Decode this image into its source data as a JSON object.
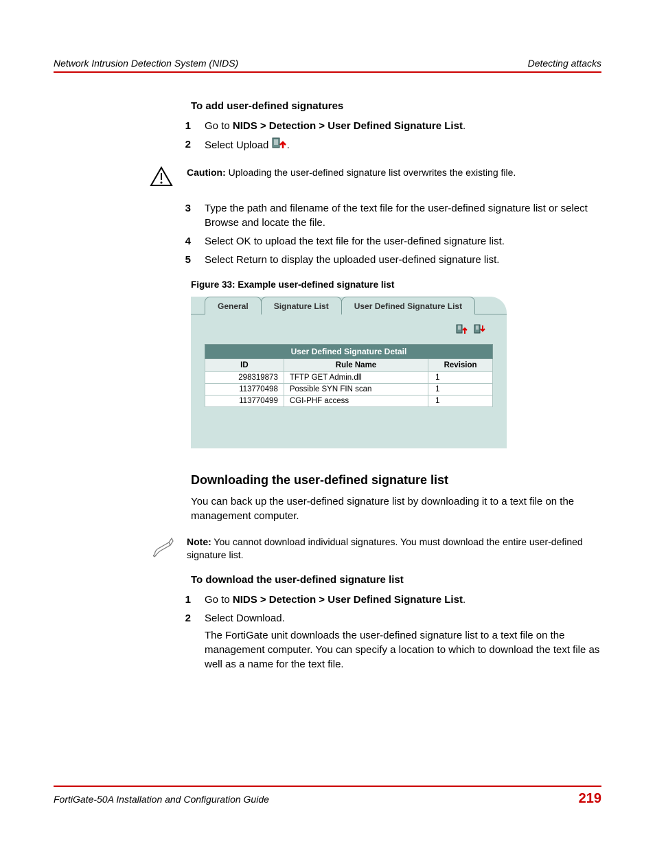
{
  "header": {
    "left": "Network Intrusion Detection System (NIDS)",
    "right": "Detecting attacks"
  },
  "proc1": {
    "title": "To add user-defined signatures",
    "steps": {
      "s1": {
        "num": "1",
        "pre": "Go to ",
        "bold": "NIDS > Detection > User Defined Signature List",
        "post": "."
      },
      "s2": {
        "num": "2",
        "pre": "Select Upload ",
        "post": "."
      },
      "s3": {
        "num": "3",
        "text": "Type the path and filename of the text file for the user-defined signature list or select Browse and locate the file."
      },
      "s4": {
        "num": "4",
        "text": "Select OK to upload the text file for the user-defined signature list."
      },
      "s5": {
        "num": "5",
        "text": "Select Return to display the uploaded user-defined signature list."
      }
    }
  },
  "caution": {
    "label": "Caution:",
    "text": " Uploading the user-defined signature list overwrites the existing file."
  },
  "figure": {
    "caption": "Figure 33: Example user-defined signature list",
    "tabs": [
      "General",
      "Signature List",
      "User Defined Signature List"
    ],
    "titlebar": "User Defined Signature Detail",
    "cols": [
      "ID",
      "Rule Name",
      "Revision"
    ],
    "rows": [
      {
        "id": "298319873",
        "name": "TFTP GET Admin.dll",
        "rev": "1"
      },
      {
        "id": "113770498",
        "name": "Possible SYN FIN scan",
        "rev": "1"
      },
      {
        "id": "113770499",
        "name": "CGI-PHF access",
        "rev": "1"
      }
    ]
  },
  "section2": {
    "heading": "Downloading the user-defined signature list",
    "para": "You can back up the user-defined signature list by downloading it to a text file on the management computer."
  },
  "note": {
    "label": "Note:",
    "text": " You cannot download individual signatures. You must download the entire user-defined signature list."
  },
  "proc2": {
    "title": "To download the user-defined signature list",
    "steps": {
      "s1": {
        "num": "1",
        "pre": "Go to ",
        "bold": "NIDS > Detection > User Defined Signature List",
        "post": "."
      },
      "s2": {
        "num": "2",
        "text": "Select Download.",
        "sub": "The FortiGate unit downloads the user-defined signature list to a text file on the management computer. You can specify a location to which to download the text file as well as a name for the text file."
      }
    }
  },
  "footer": {
    "title": "FortiGate-50A Installation and Configuration Guide",
    "page": "219"
  }
}
